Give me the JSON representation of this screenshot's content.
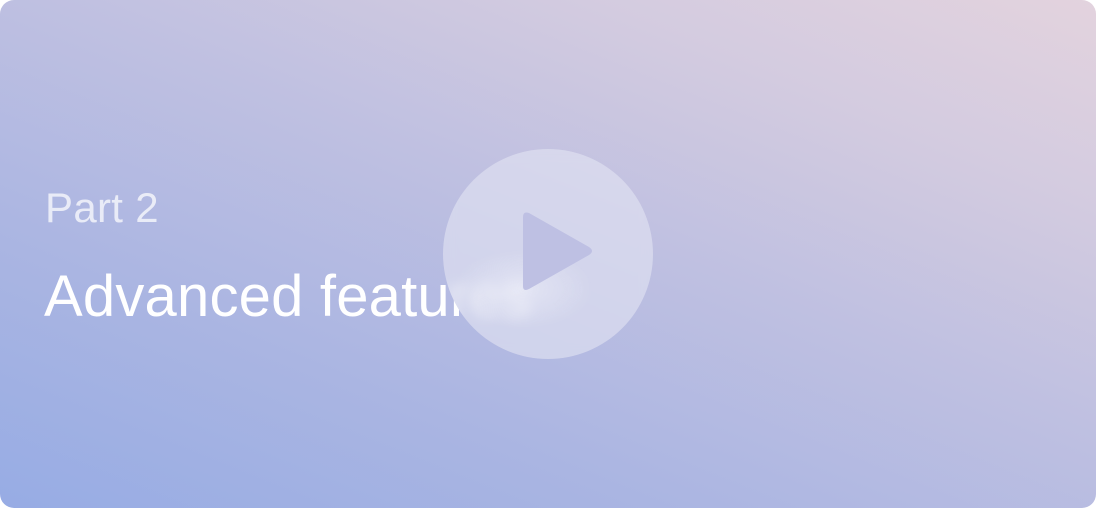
{
  "video_card": {
    "part_label": "Part 2",
    "title": "Advanced features"
  },
  "play_button": {
    "icon": "play-icon"
  },
  "colors": {
    "gradient_start": "#97ace4",
    "gradient_end": "#e3d3de",
    "play_triangle": "#bec0e3"
  }
}
